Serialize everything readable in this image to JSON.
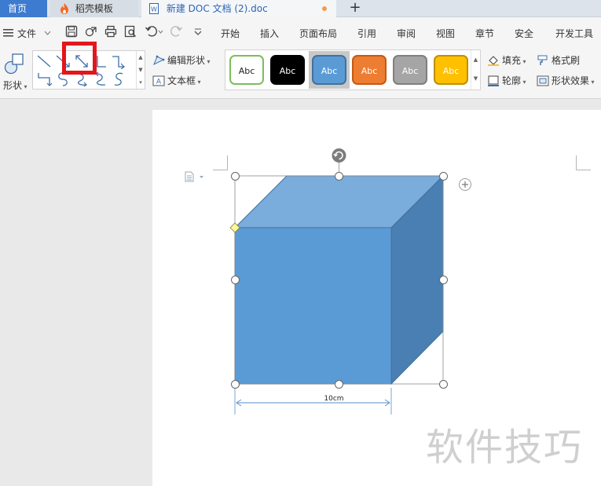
{
  "tabs": {
    "home": "首页",
    "template": "稻壳模板",
    "document": "新建 DOC 文档 (2).doc",
    "new_tab_symbol": "+"
  },
  "menubar": {
    "file": "文件",
    "items": [
      "开始",
      "插入",
      "页面布局",
      "引用",
      "审阅",
      "视图",
      "章节",
      "安全",
      "开发工具"
    ]
  },
  "ribbon": {
    "shapes_label": "形状",
    "edit_shape": "编辑形状",
    "textbox": "文本框",
    "style_label": "Abc",
    "fill": "填充",
    "format_painter": "格式刷",
    "outline": "轮廓",
    "shape_effects": "形状效果"
  },
  "style_presets": [
    {
      "label": "Abc",
      "bg": "#ffffff",
      "border": "#7dbd5a",
      "text": "#222222",
      "selected": false
    },
    {
      "label": "Abc",
      "bg": "#000000",
      "border": "#000000",
      "text": "#ffffff",
      "selected": false
    },
    {
      "label": "Abc",
      "bg": "#5b9bd5",
      "border": "#41719c",
      "text": "#ffffff",
      "selected": true
    },
    {
      "label": "Abc",
      "bg": "#ed7d31",
      "border": "#c55a11",
      "text": "#ffffff",
      "selected": false
    },
    {
      "label": "Abc",
      "bg": "#a5a5a5",
      "border": "#7f7f7f",
      "text": "#ffffff",
      "selected": false
    },
    {
      "label": "Abc",
      "bg": "#ffc000",
      "border": "#bf9000",
      "text": "#ffffff",
      "selected": false
    }
  ],
  "document": {
    "dimension_label": "10cm",
    "watermark": "软件技巧"
  },
  "colors": {
    "accent": "#3d7bd0",
    "cube_front": "#5b9bd5",
    "cube_top": "#7aacdc",
    "cube_side": "#4a7fb3",
    "highlight": "#e3161b"
  }
}
